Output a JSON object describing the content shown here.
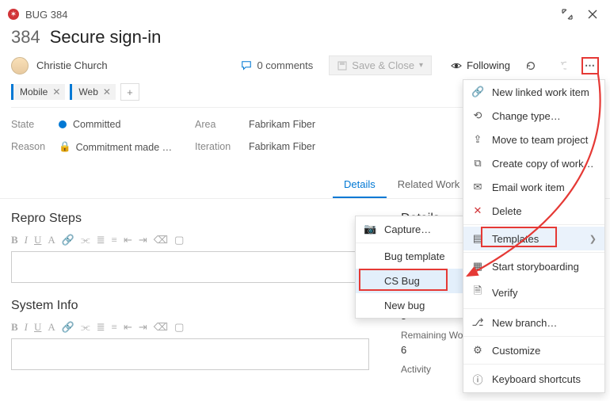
{
  "header": {
    "bug_label": "BUG 384",
    "id": "384",
    "title": "Secure sign-in"
  },
  "meta": {
    "assignee": "Christie Church",
    "comments_count": "0 comments",
    "save_close": "Save & Close",
    "following": "Following"
  },
  "tags": [
    "Mobile",
    "Web"
  ],
  "fields": {
    "state_label": "State",
    "state_value": "Committed",
    "reason_label": "Reason",
    "reason_value": "Commitment made …",
    "area_label": "Area",
    "area_value": "Fabrikam Fiber",
    "iteration_label": "Iteration",
    "iteration_value": "Fabrikam Fiber"
  },
  "tabs": {
    "details": "Details",
    "related": "Related Work item"
  },
  "sections": {
    "repro": "Repro Steps",
    "system": "System Info",
    "details": "Details",
    "capture": "Capture…",
    "remaining_label": "Remaining Work",
    "val5": "5",
    "val6": "6",
    "activity_label": "Activity"
  },
  "submenu": {
    "items": [
      "Capture…",
      "Bug template",
      "CS Bug",
      "New bug"
    ],
    "highlighted_index": 2
  },
  "menu": {
    "items": [
      {
        "icon": "link-plus-icon",
        "label": "New linked work item"
      },
      {
        "icon": "swap-icon",
        "label": "Change type…"
      },
      {
        "icon": "move-icon",
        "label": "Move to team project"
      },
      {
        "icon": "copy-icon",
        "label": "Create copy of work item…"
      },
      {
        "icon": "mail-icon",
        "label": "Email work item"
      },
      {
        "icon": "delete-icon",
        "label": "Delete",
        "delete": true
      },
      {
        "icon": "template-icon",
        "label": "Templates",
        "submenu": true,
        "highlighted": true,
        "hovered": true
      },
      {
        "icon": "storyboard-icon",
        "label": "Start storyboarding"
      },
      {
        "icon": "verify-icon",
        "label": "Verify"
      },
      {
        "icon": "branch-icon",
        "label": "New branch…"
      },
      {
        "icon": "customize-icon",
        "label": "Customize"
      },
      {
        "icon": "keyboard-icon",
        "label": "Keyboard shortcuts"
      }
    ]
  }
}
